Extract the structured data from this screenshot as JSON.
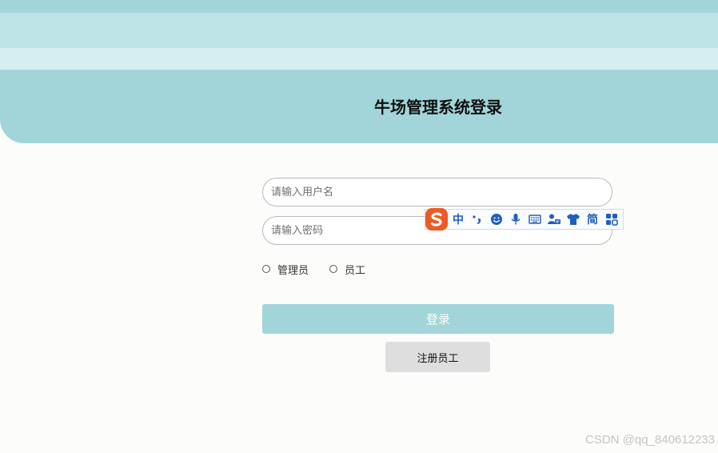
{
  "header": {
    "title": "牛场管理系统登录"
  },
  "form": {
    "username_placeholder": "请输入用户名",
    "password_placeholder": "请输入密码",
    "roles": [
      {
        "label": "管理员"
      },
      {
        "label": "员工"
      }
    ],
    "login_label": "登录",
    "register_label": "注册员工"
  },
  "ime_toolbar": {
    "logo_icon": "sogou-logo-icon",
    "language_mode": "中",
    "punctuation_icon": "punctuation-icon",
    "emoji_icon": "emoji-icon",
    "voice_icon": "microphone-icon",
    "keyboard_icon": "keyboard-icon",
    "user_icon": "user-card-icon",
    "skin_icon": "tshirt-icon",
    "script_mode": "简",
    "toolbox_icon": "toolbox-icon"
  },
  "watermark": {
    "text": "CSDN @qq_840612233"
  },
  "colors": {
    "accent": "#a1d5d9",
    "band_light": "#bfe4e7",
    "band_lighter": "#d7eef0",
    "register_bg": "#dedede",
    "ime_blue": "#1f5fbf",
    "ime_logo_orange": "#ee5a24"
  }
}
